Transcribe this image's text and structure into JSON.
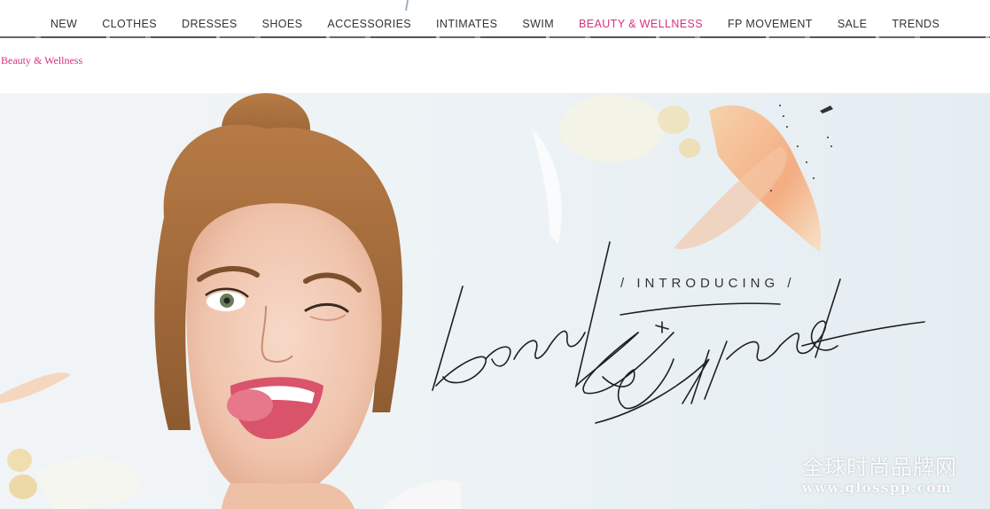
{
  "nav": {
    "items": [
      {
        "label": "NEW",
        "active": false
      },
      {
        "label": "CLOTHES",
        "active": false
      },
      {
        "label": "DRESSES",
        "active": false
      },
      {
        "label": "SHOES",
        "active": false
      },
      {
        "label": "ACCESSORIES",
        "active": false
      },
      {
        "label": "INTIMATES",
        "active": false
      },
      {
        "label": "SWIM",
        "active": false
      },
      {
        "label": "BEAUTY & WELLNESS",
        "active": true
      },
      {
        "label": "FP MOVEMENT",
        "active": false
      },
      {
        "label": "SALE",
        "active": false
      },
      {
        "label": "TRENDS",
        "active": false
      }
    ],
    "active_color": "#d6317e"
  },
  "breadcrumb": {
    "label": "Beauty & Wellness"
  },
  "hero": {
    "intro": "/ INTRODUCING /",
    "script_text": "beauty + wellness"
  },
  "watermark": {
    "chinese": "全球时尚品牌网",
    "url": "www.glosspp.com"
  }
}
